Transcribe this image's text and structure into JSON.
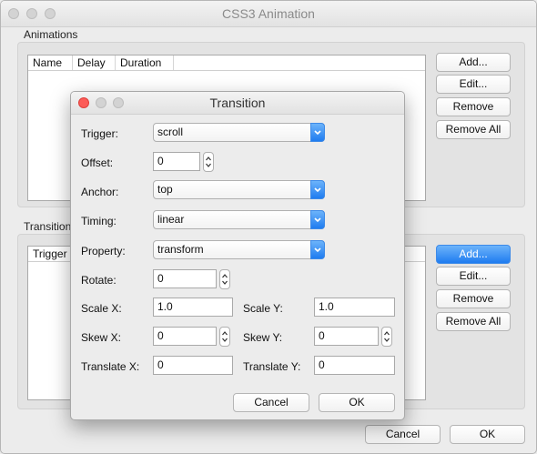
{
  "main_window": {
    "title": "CSS3 Animation",
    "animations_label": "Animations",
    "animations_columns": [
      "Name",
      "Delay",
      "Duration"
    ],
    "transitions_label": "Transitions",
    "transitions_columns": [
      "Trigger"
    ],
    "animation_buttons": {
      "add": "Add...",
      "edit": "Edit...",
      "remove": "Remove",
      "remove_all": "Remove All"
    },
    "transition_buttons": {
      "add": "Add...",
      "edit": "Edit...",
      "remove": "Remove",
      "remove_all": "Remove All"
    },
    "cancel": "Cancel",
    "ok": "OK"
  },
  "dialog": {
    "title": "Transition",
    "trigger_label": "Trigger:",
    "trigger_value": "scroll",
    "offset_label": "Offset:",
    "offset_value": "0",
    "anchor_label": "Anchor:",
    "anchor_value": "top",
    "timing_label": "Timing:",
    "timing_value": "linear",
    "property_label": "Property:",
    "property_value": "transform",
    "rotate_label": "Rotate:",
    "rotate_value": "0",
    "scale_x_label": "Scale X:",
    "scale_x_value": "1.0",
    "scale_y_label": "Scale Y:",
    "scale_y_value": "1.0",
    "skew_x_label": "Skew X:",
    "skew_x_value": "0",
    "skew_y_label": "Skew Y:",
    "skew_y_value": "0",
    "translate_x_label": "Translate X:",
    "translate_x_value": "0",
    "translate_y_label": "Translate Y:",
    "translate_y_value": "0",
    "cancel": "Cancel",
    "ok": "OK"
  },
  "colors": {
    "accent": "#1f7cf0",
    "close_button": "#fc5b57"
  },
  "icons": [
    "close-icon",
    "minimize-icon",
    "zoom-icon",
    "chevron-down-icon",
    "stepper-icon"
  ]
}
